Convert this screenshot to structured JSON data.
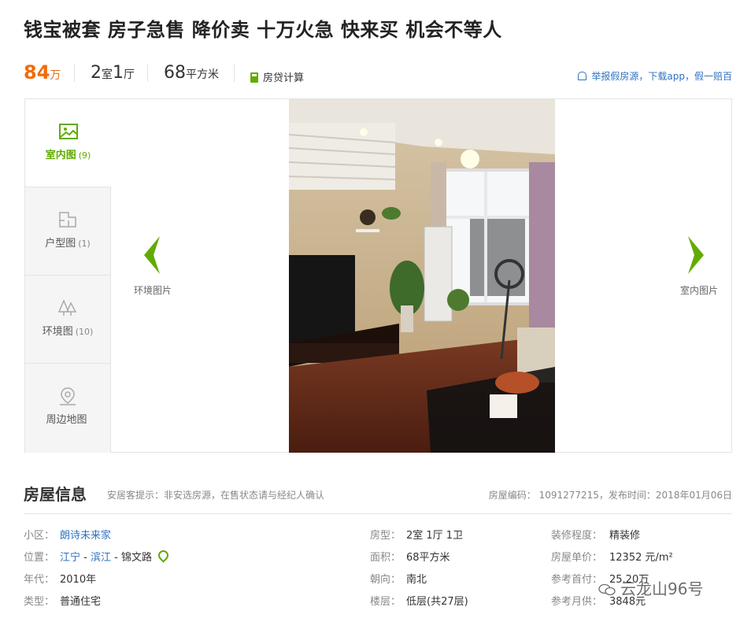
{
  "title": "钱宝被套 房子急售 降价卖 十万火急 快来买 机会不等人",
  "summary": {
    "price": "84",
    "price_unit": "万",
    "rooms_num1": "2",
    "rooms_unit1": "室",
    "rooms_num2": "1",
    "rooms_unit2": "厅",
    "area": "68",
    "area_unit": "平方米",
    "loan_calc": "房贷计算",
    "report": "举报假房源，下载app，假一赔百"
  },
  "gallery": {
    "tabs": [
      {
        "label": "室内图",
        "count": "(9)",
        "icon": "image-icon"
      },
      {
        "label": "户型图",
        "count": "(1)",
        "icon": "floorplan-icon"
      },
      {
        "label": "环境图",
        "count": "(10)",
        "icon": "trees-icon"
      },
      {
        "label": "周边地图",
        "count": "",
        "icon": "map-pin-icon"
      }
    ],
    "prev_label": "环境图片",
    "next_label": "室内图片"
  },
  "info": {
    "title": "房屋信息",
    "tip": "安居客提示：非安选房源，在售状态请与经纪人确认",
    "code": "房屋编码： 1091277215，发布时间：2018年01月06日",
    "community_label": "小区：",
    "community": "朗诗未来家",
    "location_label": "位置：",
    "location_district": "江宁",
    "location_area": "滨江",
    "location_road": "锦文路",
    "location_sep": " - ",
    "year_label": "年代：",
    "year": "2010年",
    "type_label": "类型：",
    "type": "普通住宅",
    "layout_label": "房型：",
    "layout": "2室 1厅 1卫",
    "area_label": "面积：",
    "area": "68平方米",
    "orientation_label": "朝向：",
    "orientation": "南北",
    "floor_label": "楼层：",
    "floor": "低层(共27层)",
    "decoration_label": "装修程度：",
    "decoration": "精装修",
    "unit_price_label": "房屋单价：",
    "unit_price": "12352 元/m²",
    "down_payment_label": "参考首付：",
    "down_payment": "25.20万",
    "monthly_label": "参考月供：",
    "monthly": "3848元"
  },
  "watermark": "云龙山96号",
  "colors": {
    "accent_green": "#62ab00",
    "price_orange": "#f06c0c",
    "link_blue": "#3072c2"
  }
}
